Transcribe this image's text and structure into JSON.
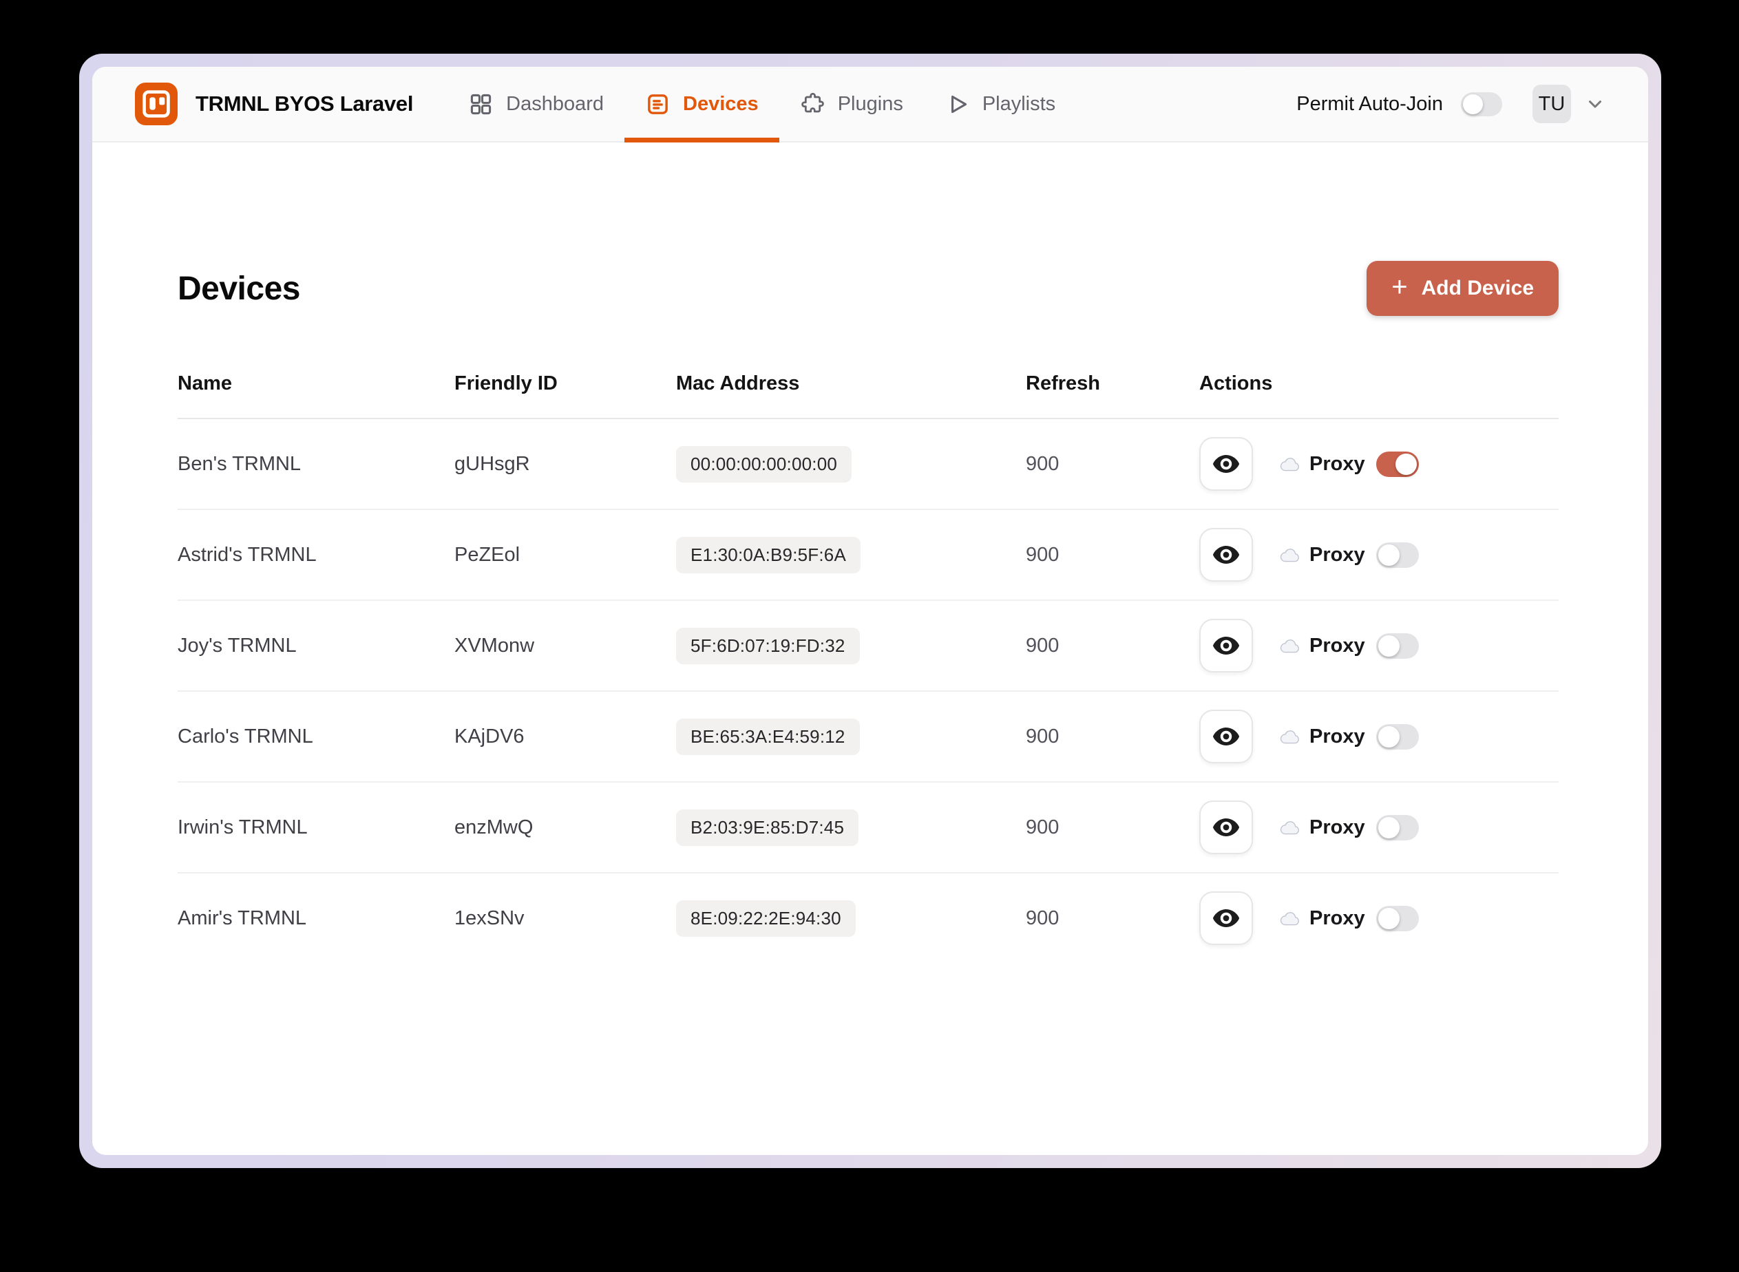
{
  "app": {
    "title": "TRMNL BYOS Laravel"
  },
  "header": {
    "nav": [
      {
        "label": "Dashboard",
        "icon": "grid-icon",
        "active": false
      },
      {
        "label": "Devices",
        "icon": "list-box-icon",
        "active": true
      },
      {
        "label": "Plugins",
        "icon": "puzzle-icon",
        "active": false
      },
      {
        "label": "Playlists",
        "icon": "play-icon",
        "active": false
      }
    ],
    "permit_auto_join": {
      "label": "Permit Auto-Join",
      "enabled": false
    },
    "user": {
      "initials": "TU"
    }
  },
  "page": {
    "title": "Devices",
    "add_button": {
      "label": "Add Device",
      "icon": "plus-icon",
      "plus": "+"
    }
  },
  "table": {
    "columns": [
      "Name",
      "Friendly ID",
      "Mac Address",
      "Refresh",
      "Actions"
    ],
    "proxy_label": "Proxy",
    "rows": [
      {
        "name": "Ben's TRMNL",
        "friendly_id": "gUHsgR",
        "mac": "00:00:00:00:00:00",
        "refresh": "900",
        "proxy_enabled": true
      },
      {
        "name": "Astrid's TRMNL",
        "friendly_id": "PeZEol",
        "mac": "E1:30:0A:B9:5F:6A",
        "refresh": "900",
        "proxy_enabled": false
      },
      {
        "name": "Joy's TRMNL",
        "friendly_id": "XVMonw",
        "mac": "5F:6D:07:19:FD:32",
        "refresh": "900",
        "proxy_enabled": false
      },
      {
        "name": "Carlo's TRMNL",
        "friendly_id": "KAjDV6",
        "mac": "BE:65:3A:E4:59:12",
        "refresh": "900",
        "proxy_enabled": false
      },
      {
        "name": "Irwin's TRMNL",
        "friendly_id": "enzMwQ",
        "mac": "B2:03:9E:85:D7:45",
        "refresh": "900",
        "proxy_enabled": false
      },
      {
        "name": "Amir's TRMNL",
        "friendly_id": "1exSNv",
        "mac": "8E:09:22:2E:94:30",
        "refresh": "900",
        "proxy_enabled": false
      }
    ]
  },
  "colors": {
    "brand_orange": "#E2580A",
    "primary_terracotta": "#C8624C",
    "header_bg": "#FAFAFA",
    "frame_left": "#D8D5EF",
    "frame_right": "#EAE0E7"
  }
}
